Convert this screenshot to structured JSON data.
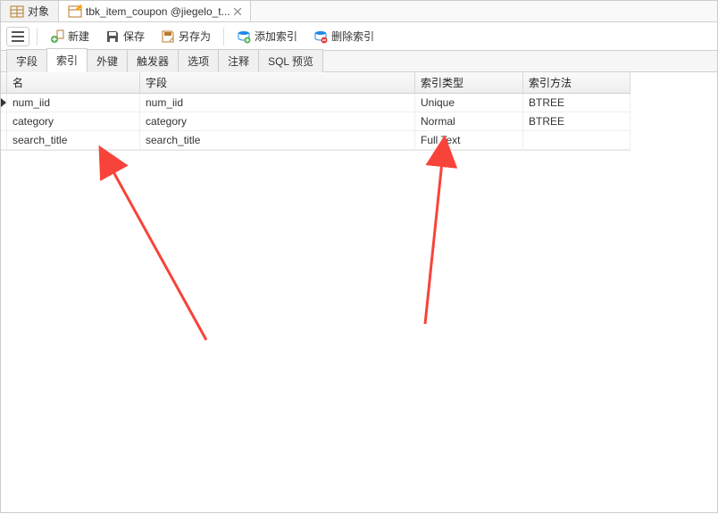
{
  "top_tabs": {
    "object_tab": "对象",
    "main_tab": "tbk_item_coupon @jiegelo_t..."
  },
  "toolbar": {
    "new_label": "新建",
    "save_label": "保存",
    "saveas_label": "另存为",
    "add_index_label": "添加索引",
    "delete_index_label": "删除索引"
  },
  "sub_tabs": [
    "字段",
    "索引",
    "外键",
    "触发器",
    "选项",
    "注释",
    "SQL 预览"
  ],
  "sub_tab_active_index": 1,
  "grid_headers": [
    "名",
    "字段",
    "索引类型",
    "索引方法"
  ],
  "rows": [
    {
      "name": "num_iid",
      "field": "num_iid",
      "type": "Unique",
      "method": "BTREE"
    },
    {
      "name": "category",
      "field": "category",
      "type": "Normal",
      "method": "BTREE"
    },
    {
      "name": "search_title",
      "field": "search_title",
      "type": "Full Text",
      "method": ""
    }
  ],
  "colors": {
    "arrow": "#f8433a",
    "green": "#4caf50",
    "blue": "#1e88e5"
  }
}
